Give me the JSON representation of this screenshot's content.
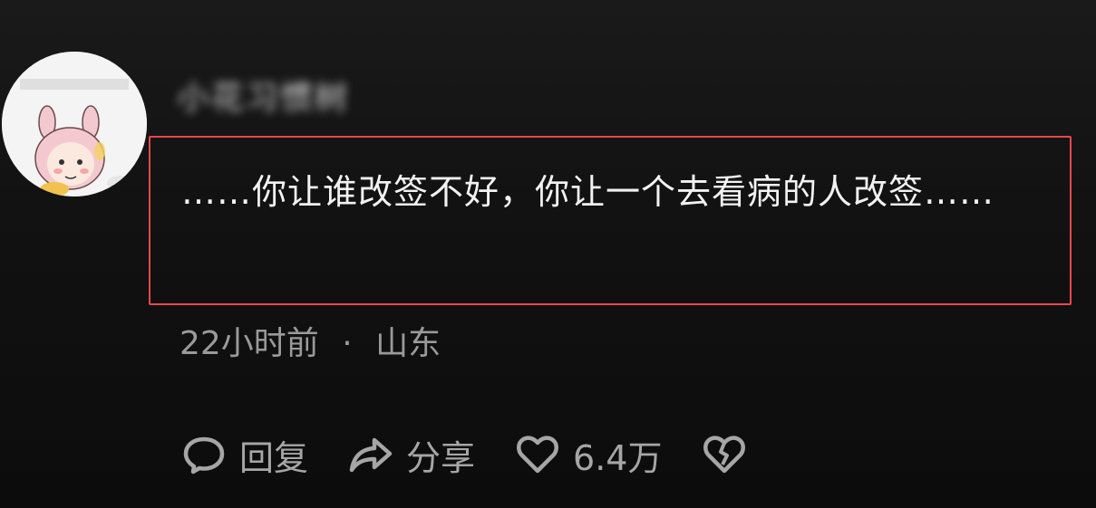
{
  "comment": {
    "username": "小花习惯树",
    "text": "……你让谁改签不好，你让一个去看病的人改签……",
    "time": "22小时前",
    "separator": "·",
    "location": "山东"
  },
  "actions": {
    "reply_label": "回复",
    "share_label": "分享",
    "like_count": "6.4万"
  },
  "icons": {
    "reply": "speech-bubble-icon",
    "share": "share-arrow-icon",
    "like": "heart-icon",
    "dislike": "broken-heart-icon"
  },
  "colors": {
    "highlight_border": "#e8484b",
    "text_primary": "#f2f2f2",
    "text_secondary": "#9a9a9a"
  }
}
